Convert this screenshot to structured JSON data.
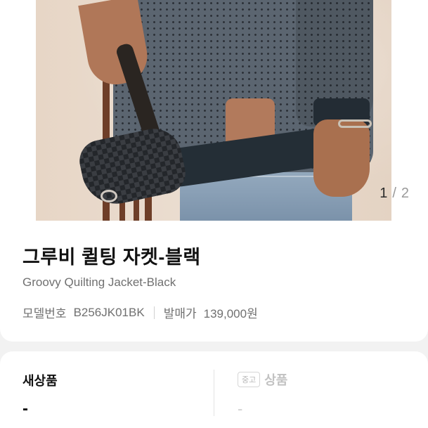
{
  "image": {
    "counter_current": "1",
    "counter_separator": "/",
    "counter_total": "2"
  },
  "product": {
    "title": "그루비 퀼팅 자켓-블랙",
    "subtitle": "Groovy Quilting Jacket-Black",
    "model_label": "모델번호",
    "model_value": "B256JK01BK",
    "price_label": "발매가",
    "price_value": "139,000원"
  },
  "options": {
    "new_label": "새상품",
    "new_value": "-",
    "used_tag": "중고",
    "used_label": "상품",
    "used_value": "-"
  },
  "colors": {
    "background": "#f2f2f2",
    "card": "#ffffff",
    "title_text": "#111111",
    "muted_text": "#707070",
    "disabled_text": "#c2c2c2"
  }
}
